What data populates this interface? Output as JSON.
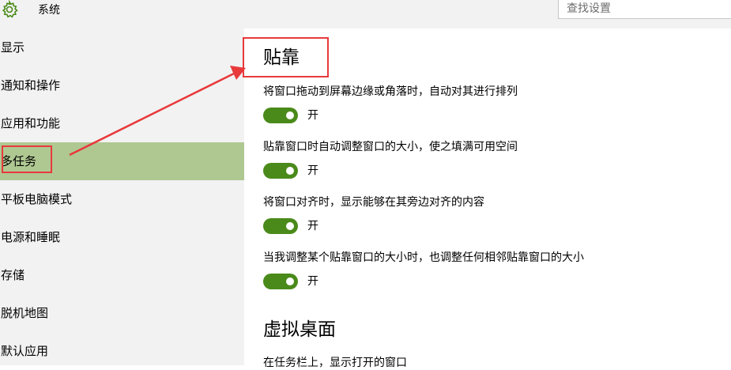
{
  "header": {
    "app_title": "系统",
    "app_icon": "gear-icon",
    "search_placeholder": "查找设置"
  },
  "sidebar": {
    "items": [
      {
        "label": "显示",
        "selected": false
      },
      {
        "label": "通知和操作",
        "selected": false
      },
      {
        "label": "应用和功能",
        "selected": false
      },
      {
        "label": "多任务",
        "selected": true
      },
      {
        "label": "平板电脑模式",
        "selected": false
      },
      {
        "label": "电源和睡眠",
        "selected": false
      },
      {
        "label": "存储",
        "selected": false
      },
      {
        "label": "脱机地图",
        "selected": false
      },
      {
        "label": "默认应用",
        "selected": false
      }
    ]
  },
  "main": {
    "section_snap_title": "贴靠",
    "settings": [
      {
        "label": "将窗口拖动到屏幕边缘或角落时，自动对其进行排列",
        "toggle": "开"
      },
      {
        "label": "贴靠窗口时自动调整窗口的大小，使之填满可用空间",
        "toggle": "开"
      },
      {
        "label": "将窗口对齐时，显示能够在其旁边对齐的内容",
        "toggle": "开"
      },
      {
        "label": "当我调整某个贴靠窗口的大小时，也调整任何相邻贴靠窗口的大小",
        "toggle": "开"
      }
    ],
    "section_virtual_title": "虚拟桌面",
    "partial_label": "在任务栏上，显示打开的窗口"
  },
  "colors": {
    "sidebar_bg": "#f2f2f2",
    "selected_bg": "#afc892",
    "toggle_on": "#4a8a1a",
    "annotation": "#e8393b"
  }
}
